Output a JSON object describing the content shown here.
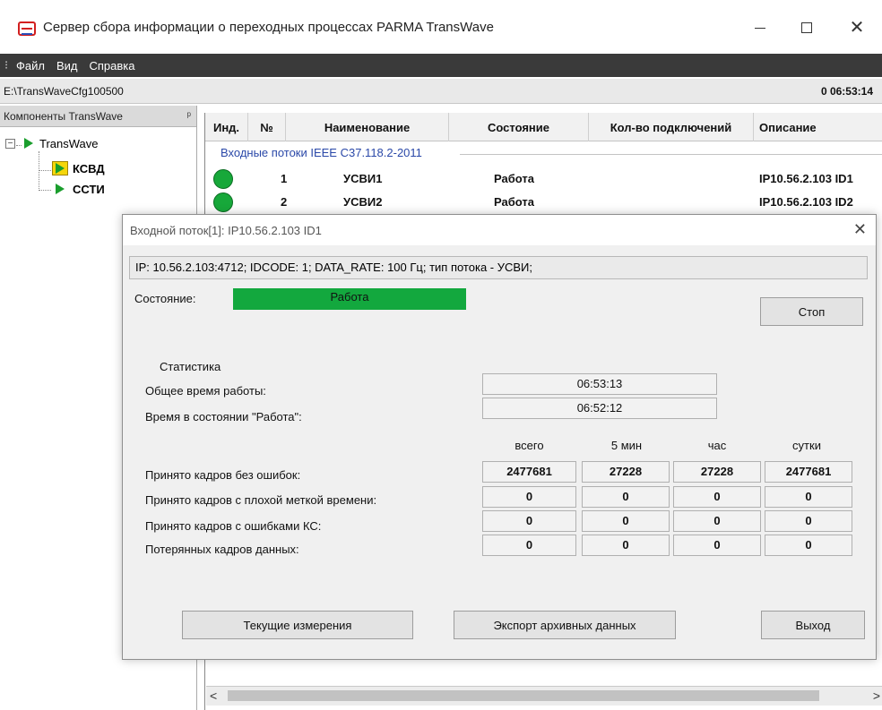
{
  "window": {
    "title": "Сервер сбора информации о переходных процессах PARMA TransWave",
    "minimize": "",
    "maximize": "",
    "close": "✕"
  },
  "menu": {
    "grip": "⁝",
    "items": [
      "Файл",
      "Вид",
      "Справка"
    ]
  },
  "pathbar": {
    "path": "E:\\TransWaveCfg100500",
    "time": "0 06:53:14"
  },
  "left_panel": {
    "title": "Компоненты TransWave",
    "pin": "ㅁ",
    "tree": {
      "root": {
        "expander": "−",
        "label": "TransWave"
      },
      "children": [
        {
          "label": "КСВД"
        },
        {
          "label": "ССТИ"
        }
      ]
    }
  },
  "table": {
    "columns": [
      "Инд.",
      "№",
      "Наименование",
      "Состояние",
      "Кол-во подключений",
      "Описание"
    ],
    "group": "Входные потоки IEEE C37.118.2-2011",
    "rows": [
      {
        "num": "1",
        "name": "УСВИ1",
        "state": "Работа",
        "connections": "",
        "description": "IP10.56.2.103 ID1"
      },
      {
        "num": "2",
        "name": "УСВИ2",
        "state": "Работа",
        "connections": "",
        "description": "IP10.56.2.103 ID2"
      }
    ],
    "scroll_left": "<",
    "scroll_right": ">"
  },
  "dialog": {
    "title": "Входной поток[1]: IP10.56.2.103 ID1",
    "close": "✕",
    "info": "IP: 10.56.2.103:4712;   IDCODE: 1;   DATA_RATE: 100 Гц;    тип потока - УСВИ;",
    "state_label": "Состояние:",
    "state_value": "Работа",
    "stop_button": "Стоп",
    "stats_title": "Статистика",
    "total_time_label": "Общее время работы:",
    "total_time_value": "06:53:13",
    "work_time_label": "Время в состоянии \"Работа\":",
    "work_time_value": "06:52:12",
    "col_headers": [
      "всего",
      "5 мин",
      "час",
      "сутки"
    ],
    "stats_rows": [
      {
        "label": "Принято кадров без ошибок:",
        "values": [
          "2477681",
          "27228",
          "27228",
          "2477681"
        ]
      },
      {
        "label": "Принято кадров с плохой меткой времени:",
        "values": [
          "0",
          "0",
          "0",
          "0"
        ]
      },
      {
        "label": "Принято кадров с ошибками КС:",
        "values": [
          "0",
          "0",
          "0",
          "0"
        ]
      },
      {
        "label": "Потерянных кадров данных:",
        "values": [
          "0",
          "0",
          "0",
          "0"
        ]
      }
    ],
    "btn_current": "Текущие измерения",
    "btn_export": "Экспорт архивных данных",
    "btn_exit": "Выход"
  },
  "colors": {
    "status_green": "#17a83a",
    "menubar": "#3a3a3a",
    "group_title": "#2a48a8"
  }
}
